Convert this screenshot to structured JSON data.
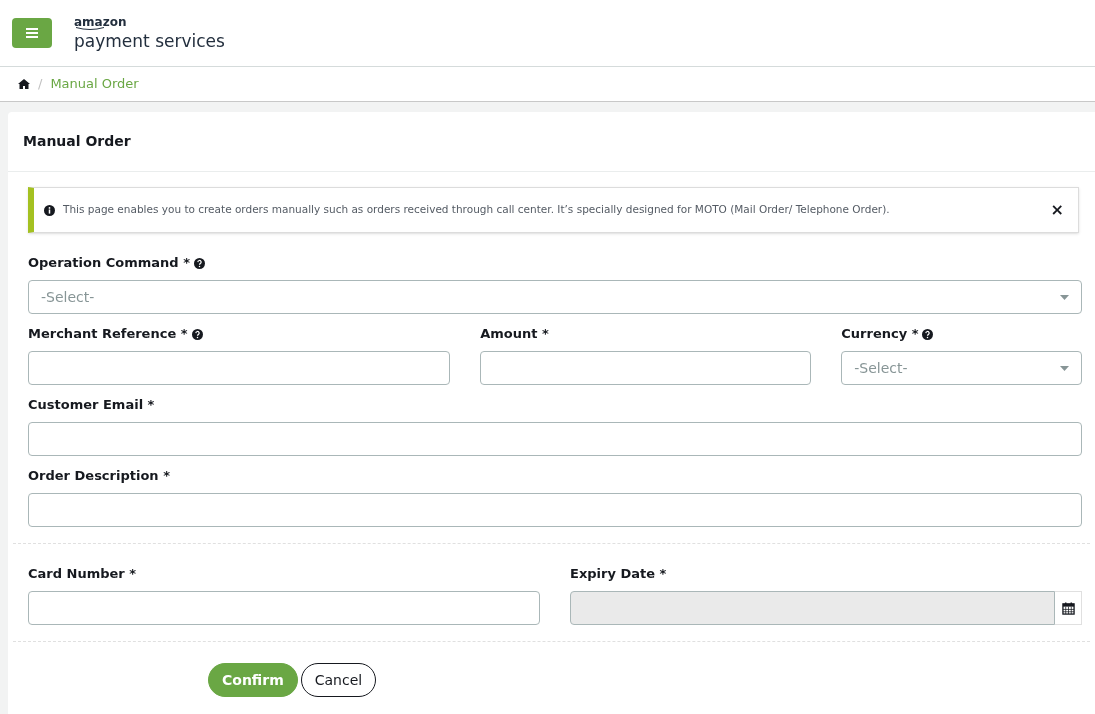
{
  "header": {
    "brand_top": "amazon",
    "brand_bottom": "payment services"
  },
  "breadcrumb": [
    {
      "separator": "/",
      "label": "Manual Order"
    }
  ],
  "card": {
    "title": "Manual Order",
    "alert": {
      "text": "This page enables you to create orders manually such as orders received through call center. It’s specially designed for MOTO (Mail Order/ Telephone Order).",
      "close": "×"
    },
    "sections": [
      {
        "rows": [
          [
            {
              "label": "Operation Command *",
              "help": true,
              "kind": "select",
              "placeholder": "-Select-"
            }
          ],
          [
            {
              "label": "Merchant Reference *",
              "help": true,
              "kind": "text"
            },
            {
              "label": "Amount *",
              "help": false,
              "kind": "text"
            },
            {
              "label": "Currency *",
              "help": true,
              "kind": "select",
              "placeholder": "-Select-"
            }
          ],
          [
            {
              "label": "Customer Email *",
              "help": false,
              "kind": "text"
            }
          ],
          [
            {
              "label": "Order Description *",
              "help": false,
              "kind": "text"
            }
          ]
        ]
      },
      {
        "rows": [
          [
            {
              "label": "Card Number *",
              "help": false,
              "kind": "text"
            },
            {
              "label": "Expiry Date *",
              "help": false,
              "kind": "date",
              "disabled": true
            }
          ]
        ]
      }
    ],
    "buttons": [
      {
        "label": "Confirm",
        "kind": "primary"
      },
      {
        "label": "Cancel",
        "kind": "secondary"
      }
    ]
  }
}
